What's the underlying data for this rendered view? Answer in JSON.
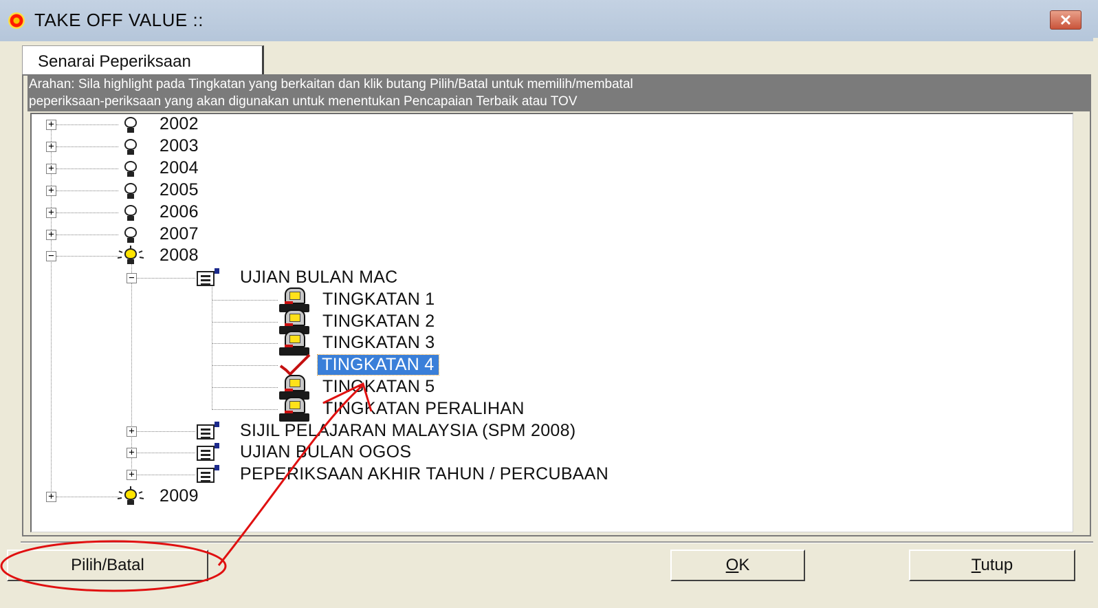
{
  "window": {
    "title": "TAKE OFF VALUE ::",
    "close_icon": "close-icon"
  },
  "tab": {
    "label": "Senarai Peperiksaan"
  },
  "instructions": {
    "line1": "Arahan: Sila highlight pada Tingkatan yang berkaitan dan klik butang Pilih/Batal  untuk memilih/membatal",
    "line2": "peperiksaan-periksaan yang akan digunakan untuk menentukan Pencapaian Terbaik atau TOV"
  },
  "tree": {
    "years": [
      {
        "label": "2002",
        "expanded": false,
        "icon": "bulb-off-icon"
      },
      {
        "label": "2003",
        "expanded": false,
        "icon": "bulb-off-icon"
      },
      {
        "label": "2004",
        "expanded": false,
        "icon": "bulb-off-icon"
      },
      {
        "label": "2005",
        "expanded": false,
        "icon": "bulb-off-icon"
      },
      {
        "label": "2006",
        "expanded": false,
        "icon": "bulb-off-icon"
      },
      {
        "label": "2007",
        "expanded": false,
        "icon": "bulb-off-icon"
      },
      {
        "label": "2008",
        "expanded": true,
        "icon": "bulb-lit-icon"
      },
      {
        "label": "2009",
        "expanded": false,
        "icon": "bulb-lit-icon"
      }
    ],
    "exams_2008": [
      {
        "label": "UJIAN BULAN MAC",
        "expanded": true,
        "icon": "exam-icon"
      },
      {
        "label": "SIJIL PELAJARAN MALAYSIA (SPM 2008)",
        "expanded": false,
        "icon": "exam-icon"
      },
      {
        "label": "UJIAN BULAN OGOS",
        "expanded": false,
        "icon": "exam-icon"
      },
      {
        "label": "PEPERIKSAAN AKHIR TAHUN / PERCUBAAN",
        "expanded": false,
        "icon": "exam-icon"
      }
    ],
    "levels_mac": [
      {
        "label": "TINGKATAN 1",
        "icon": "computer-icon",
        "selected": false
      },
      {
        "label": "TINGKATAN 2",
        "icon": "computer-icon",
        "selected": false
      },
      {
        "label": "TINGKATAN 3",
        "icon": "computer-icon",
        "selected": false
      },
      {
        "label": "TINGKATAN 4",
        "icon": "checkmark-icon",
        "selected": true
      },
      {
        "label": "TINGKATAN 5",
        "icon": "computer-icon",
        "selected": false
      },
      {
        "label": "TINGKATAN PERALIHAN",
        "icon": "computer-icon",
        "selected": false
      }
    ]
  },
  "buttons": {
    "select_toggle": "Pilih/Batal",
    "ok_prefix": "O",
    "ok_rest": "K",
    "close_prefix": "T",
    "close_rest": "utup"
  },
  "colors": {
    "selection": "#3a7fd9",
    "annotation": "#e01010",
    "instruction_bg": "#7b7b7b"
  }
}
